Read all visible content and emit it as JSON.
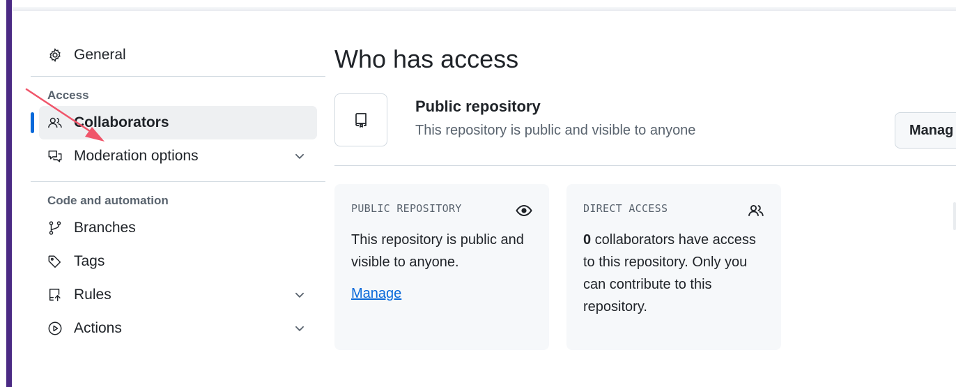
{
  "sidebar": {
    "general": "General",
    "section_access": "Access",
    "collaborators": "Collaborators",
    "moderation": "Moderation options",
    "section_code": "Code and automation",
    "branches": "Branches",
    "tags": "Tags",
    "rules": "Rules",
    "actions": "Actions"
  },
  "main": {
    "title": "Who has access",
    "repo_title": "Public repository",
    "repo_subtitle": "This repository is public and visible to anyone",
    "manage_button": "Manag",
    "public_card": {
      "label": "PUBLIC REPOSITORY",
      "text": "This repository is public and visible to anyone.",
      "link": "Manage"
    },
    "direct_card": {
      "label": "DIRECT ACCESS",
      "count": "0",
      "text_rest": " collaborators have access to this repository. Only you can contribute to this repository."
    }
  },
  "colors": {
    "accent": "#0969da",
    "rail": "#4b2a84",
    "annotation": "#f0556a"
  },
  "icons": {
    "general": "gear-icon",
    "collaborators": "people-icon",
    "moderation": "comment-discussion-icon",
    "branches": "git-branch-icon",
    "tags": "tag-icon",
    "rules": "repo-push-icon",
    "actions": "play-icon",
    "repo": "repo-icon",
    "eye": "eye-icon"
  }
}
